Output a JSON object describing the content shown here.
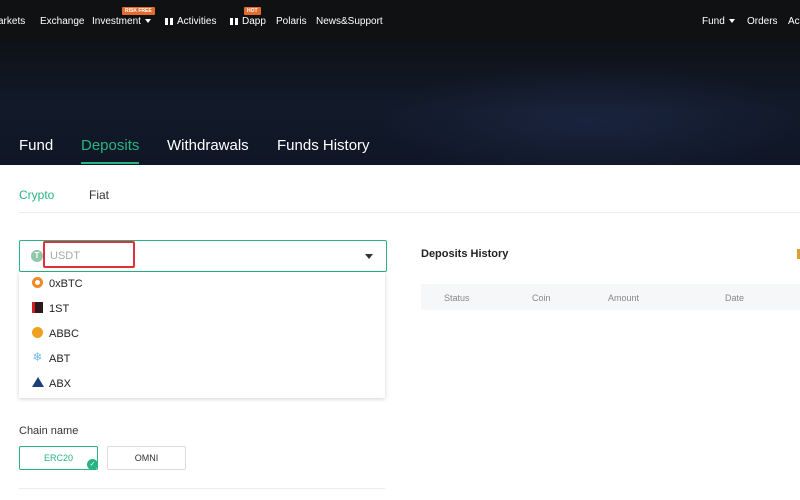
{
  "nav": {
    "items": [
      {
        "label": "arkets"
      },
      {
        "label": "Exchange"
      },
      {
        "label": "Investment",
        "badge": "RISK FREE"
      },
      {
        "label": "Activities"
      },
      {
        "label": "Dapp",
        "badge": "HOT"
      },
      {
        "label": "Polaris"
      },
      {
        "label": "News&Support"
      }
    ],
    "right": [
      {
        "label": "Fund"
      },
      {
        "label": "Orders"
      },
      {
        "label": "Acc"
      }
    ]
  },
  "hero": {
    "tabs": [
      {
        "label": "Fund"
      },
      {
        "label": "Deposits",
        "active": true
      },
      {
        "label": "Withdrawals"
      },
      {
        "label": "Funds History"
      }
    ]
  },
  "subtabs": [
    {
      "label": "Crypto",
      "active": true
    },
    {
      "label": "Fiat"
    }
  ],
  "coin_select": {
    "value": "USDT",
    "icon": "tether-icon",
    "options": [
      {
        "label": "0xBTC",
        "icon": "0xbtc-icon"
      },
      {
        "label": "1ST",
        "icon": "1st-icon"
      },
      {
        "label": "ABBC",
        "icon": "abbc-icon"
      },
      {
        "label": "ABT",
        "icon": "abt-icon"
      },
      {
        "label": "ABX",
        "icon": "abx-icon"
      }
    ]
  },
  "chain": {
    "label": "Chain name",
    "options": [
      {
        "label": "ERC20",
        "selected": true
      },
      {
        "label": "OMNI"
      }
    ]
  },
  "history": {
    "title": "Deposits History",
    "columns": [
      "Status",
      "Coin",
      "Amount",
      "Date"
    ]
  },
  "colors": {
    "accent": "#28b482",
    "highlight_box": "#e0313b",
    "nav_bg": "#0f1113",
    "badge": "#e36b2c"
  }
}
